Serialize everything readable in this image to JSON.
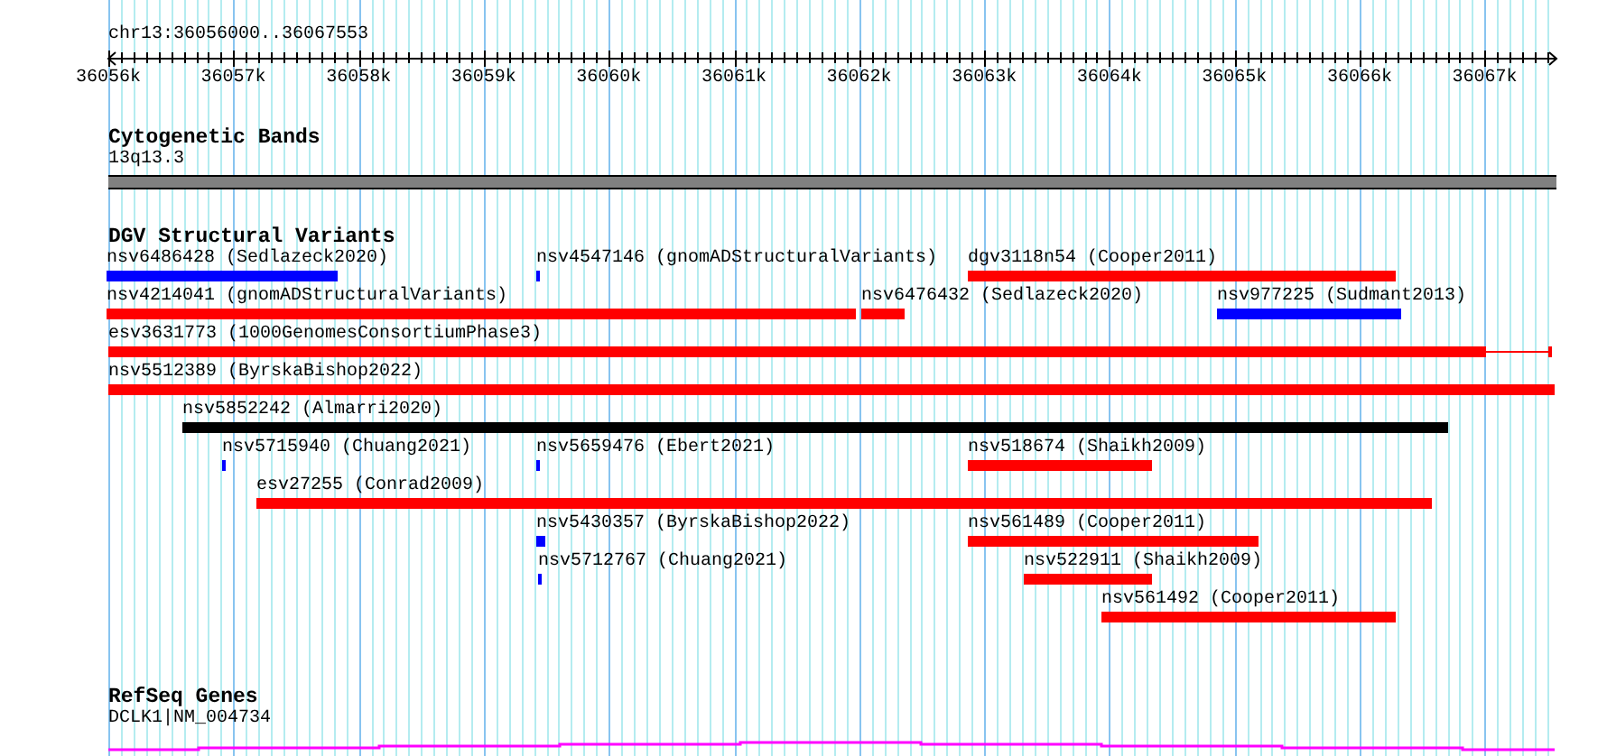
{
  "ruler": {
    "location": "chr13:36056000..36067553",
    "ticks": [
      "36056k",
      "36057k",
      "36058k",
      "36059k",
      "36060k",
      "36061k",
      "36062k",
      "36063k",
      "36064k",
      "36065k",
      "36066k",
      "36067k"
    ]
  },
  "tracks": [
    {
      "kind": "cytoband",
      "title": "Cytogenetic Bands",
      "band": "13q13.3"
    },
    {
      "kind": "variants",
      "title": "DGV Structural Variants",
      "rows": [
        [
          {
            "label": "nsv6486428 (Sedlazeck2020)",
            "color": "#0000ff"
          },
          {
            "label": "nsv4547146 (gnomADStructuralVariants)",
            "color": "#0000ff"
          },
          {
            "label": "dgv3118n54 (Cooper2011)",
            "color": "#ff0000"
          }
        ],
        [
          {
            "label": "nsv4214041 (gnomADStructuralVariants)",
            "color": "#ff0000"
          },
          {
            "label": "nsv6476432 (Sedlazeck2020)",
            "color": "#ff0000"
          },
          {
            "label": "nsv977225 (Sudmant2013)",
            "color": "#0000ff"
          }
        ],
        [
          {
            "label": "esv3631773 (1000GenomesConsortiumPhase3)",
            "color": "#ff0000"
          }
        ],
        [
          {
            "label": "nsv5512389 (ByrskaBishop2022)",
            "color": "#ff0000"
          }
        ],
        [
          {
            "label": "nsv5852242 (Almarri2020)",
            "color": "#000000"
          }
        ],
        [
          {
            "label": "nsv5715940 (Chuang2021)",
            "color": "#0000ff"
          },
          {
            "label": "nsv5659476 (Ebert2021)",
            "color": "#0000ff"
          },
          {
            "label": "nsv518674 (Shaikh2009)",
            "color": "#ff0000"
          }
        ],
        [
          {
            "label": "esv27255 (Conrad2009)",
            "color": "#ff0000"
          }
        ],
        [
          {
            "label": "nsv5430357 (ByrskaBishop2022)",
            "color": "#0000ff"
          },
          {
            "label": "nsv561489 (Cooper2011)",
            "color": "#ff0000"
          }
        ],
        [
          {
            "label": "nsv5712767 (Chuang2021)",
            "color": "#0000ff"
          },
          {
            "label": "nsv522911 (Shaikh2009)",
            "color": "#ff0000"
          }
        ],
        [
          {
            "label": "nsv561492 (Cooper2011)",
            "color": "#ff0000"
          }
        ]
      ]
    },
    {
      "kind": "genes",
      "title": "RefSeq Genes",
      "gene": "DCLK1|NM_004734"
    }
  ]
}
